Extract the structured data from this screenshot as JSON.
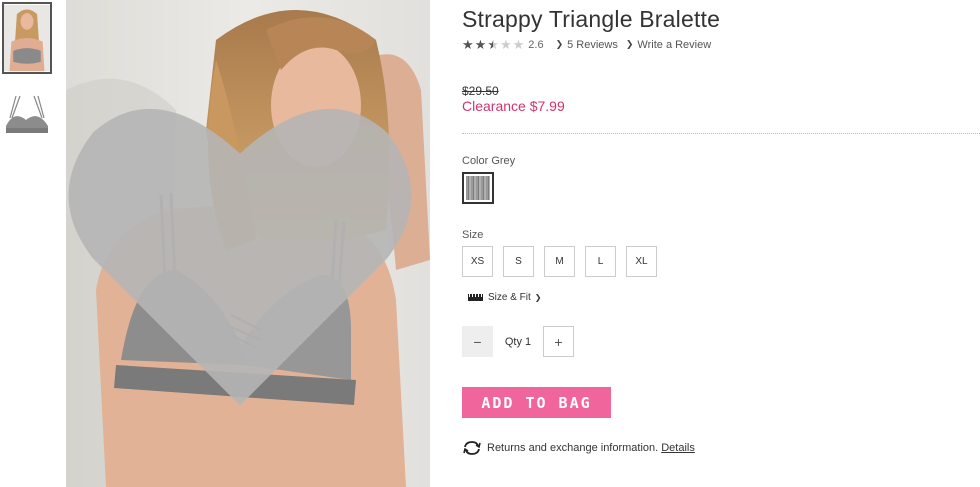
{
  "product": {
    "title": "Strappy Triangle Bralette",
    "rating": 2.6,
    "rating_text": "2.6",
    "reviews_link": "5 Reviews",
    "write_review_link": "Write a Review"
  },
  "price": {
    "original": "$29.50",
    "clearance": "Clearance $7.99"
  },
  "color": {
    "label": "Color Grey"
  },
  "size": {
    "label": "Size",
    "options": [
      "XS",
      "S",
      "M",
      "L",
      "XL"
    ],
    "size_fit": "Size & Fit"
  },
  "quantity": {
    "label": "Qty 1"
  },
  "actions": {
    "add_to_bag": "ADD TO BAG",
    "returns_text": "Returns and exchange information.",
    "details_link": "Details"
  },
  "icons": [
    "heart-icon",
    "star-icon",
    "chevron-right-icon",
    "ruler-icon",
    "minus-icon",
    "plus-icon",
    "exchange-icon"
  ],
  "colors": {
    "accent": "#f0669c",
    "sale": "#d2336e"
  }
}
